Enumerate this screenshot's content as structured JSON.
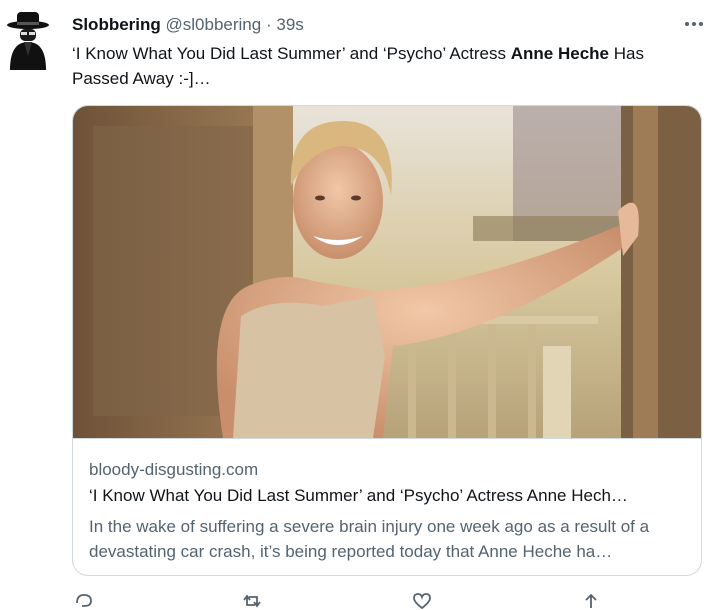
{
  "tweet": {
    "display_name": "Slobbering",
    "handle": "@sl0bbering",
    "separator": "·",
    "time": "39s",
    "text_part1": "‘I Know What You Did Last Summer’ and ‘Psycho’ Actress ",
    "text_bold": "Anne Heche",
    "text_part2": " Has Passed Away :-]…",
    "more_icon": "more-horizontal-icon"
  },
  "card": {
    "domain": "bloody-disgusting.com",
    "title": "‘I Know What You Did Last Summer’ and ‘Psycho’ Actress Anne Hech…",
    "description": "In the wake of suffering a severe brain injury one week ago as a result of a devastating car crash, it’s being reported today that Anne Heche ha…"
  },
  "actions": [
    "reply-icon",
    "retweet-icon",
    "like-icon",
    "share-icon"
  ],
  "colors": {
    "text": "#0f1419",
    "secondary": "#536471",
    "border": "#cfd9de"
  }
}
